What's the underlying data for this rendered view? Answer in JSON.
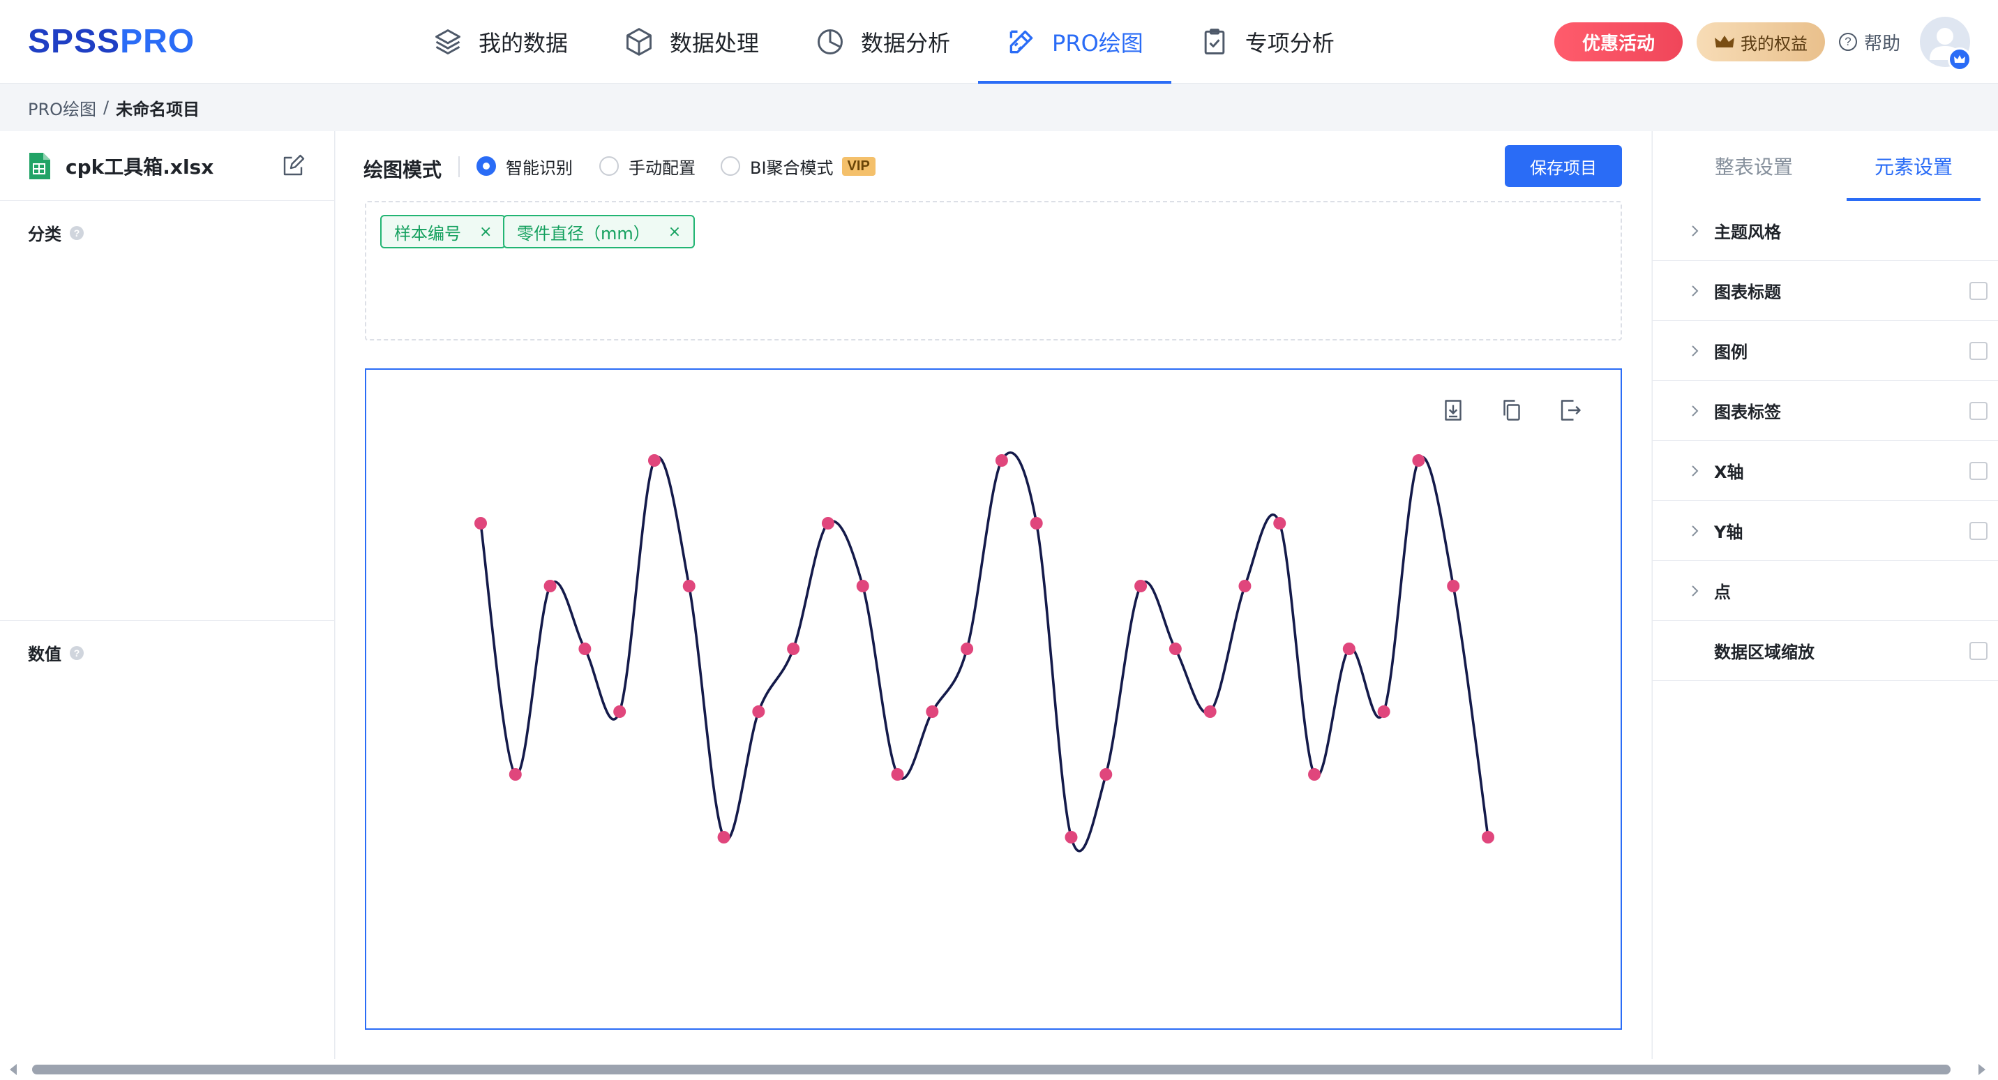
{
  "app": {
    "logo_main": "SPSS",
    "logo_accent": "PRO"
  },
  "nav": {
    "items": [
      {
        "label": "我的数据",
        "icon": "layers-icon"
      },
      {
        "label": "数据处理",
        "icon": "cube-icon"
      },
      {
        "label": "数据分析",
        "icon": "pie-chart-icon"
      },
      {
        "label": "PRO绘图",
        "icon": "ruler-pencil-icon"
      },
      {
        "label": "专项分析",
        "icon": "clipboard-check-icon"
      }
    ],
    "active_index": 3
  },
  "header": {
    "promo_label": "优惠活动",
    "rights_label": "我的权益",
    "help_label": "帮助",
    "help_symbol": "?"
  },
  "breadcrumb": {
    "parent": "PRO绘图",
    "separator": "/",
    "current": "未命名项目"
  },
  "left_panel": {
    "file_name": "cpk工具箱.xlsx",
    "sections": [
      {
        "label": "分类",
        "hint": "?"
      },
      {
        "label": "数值",
        "hint": "?"
      }
    ]
  },
  "toolbar": {
    "mode_title": "绘图模式",
    "modes": [
      {
        "label": "智能识别",
        "checked": true
      },
      {
        "label": "手动配置",
        "checked": false
      },
      {
        "label": "BI聚合模式",
        "checked": false,
        "badge": "VIP"
      }
    ],
    "save_label": "保存项目"
  },
  "fields": {
    "tags": [
      {
        "label": "样本编号",
        "remove": "×"
      },
      {
        "label": "零件直径（mm）",
        "remove": "×"
      }
    ]
  },
  "chart_tools": [
    {
      "name": "download-icon"
    },
    {
      "name": "copy-icon"
    },
    {
      "name": "export-icon"
    }
  ],
  "chart_data": {
    "type": "line",
    "smooth": true,
    "show_points": true,
    "show_axes": false,
    "grid": false,
    "title": "",
    "xlabel": "",
    "ylabel": "",
    "line_color": "#141a4a",
    "point_color": "#e0467c",
    "x": [
      1,
      2,
      3,
      4,
      5,
      6,
      7,
      8,
      9,
      10,
      11,
      12,
      13,
      14,
      15,
      16,
      17,
      18,
      19,
      20,
      21,
      22,
      23,
      24,
      25,
      26,
      27,
      28,
      29,
      30
    ],
    "values": [
      5,
      1,
      4,
      3,
      2,
      6,
      4,
      0,
      2,
      3,
      5,
      4,
      1,
      2,
      3,
      6,
      5,
      0,
      1,
      4,
      3,
      2,
      4,
      5,
      1,
      3,
      2,
      6,
      4,
      0
    ],
    "ylim": [
      0,
      6
    ]
  },
  "right_panel": {
    "tabs": [
      {
        "label": "整表设置",
        "active": false
      },
      {
        "label": "元素设置",
        "active": true
      }
    ],
    "items": [
      {
        "label": "主题风格",
        "expandable": true,
        "checkbox": false
      },
      {
        "label": "图表标题",
        "expandable": true,
        "checkbox": true
      },
      {
        "label": "图例",
        "expandable": true,
        "checkbox": true
      },
      {
        "label": "图表标签",
        "expandable": true,
        "checkbox": true
      },
      {
        "label": "X轴",
        "expandable": true,
        "checkbox": true
      },
      {
        "label": "Y轴",
        "expandable": true,
        "checkbox": true
      },
      {
        "label": "点",
        "expandable": true,
        "checkbox": false
      },
      {
        "label": "数据区域缩放",
        "expandable": false,
        "checkbox": true
      }
    ]
  },
  "colors": {
    "accent": "#2a6cf6",
    "promo": "#f0465a",
    "rights": "#e9c08c",
    "tag_green": "#22b573"
  }
}
